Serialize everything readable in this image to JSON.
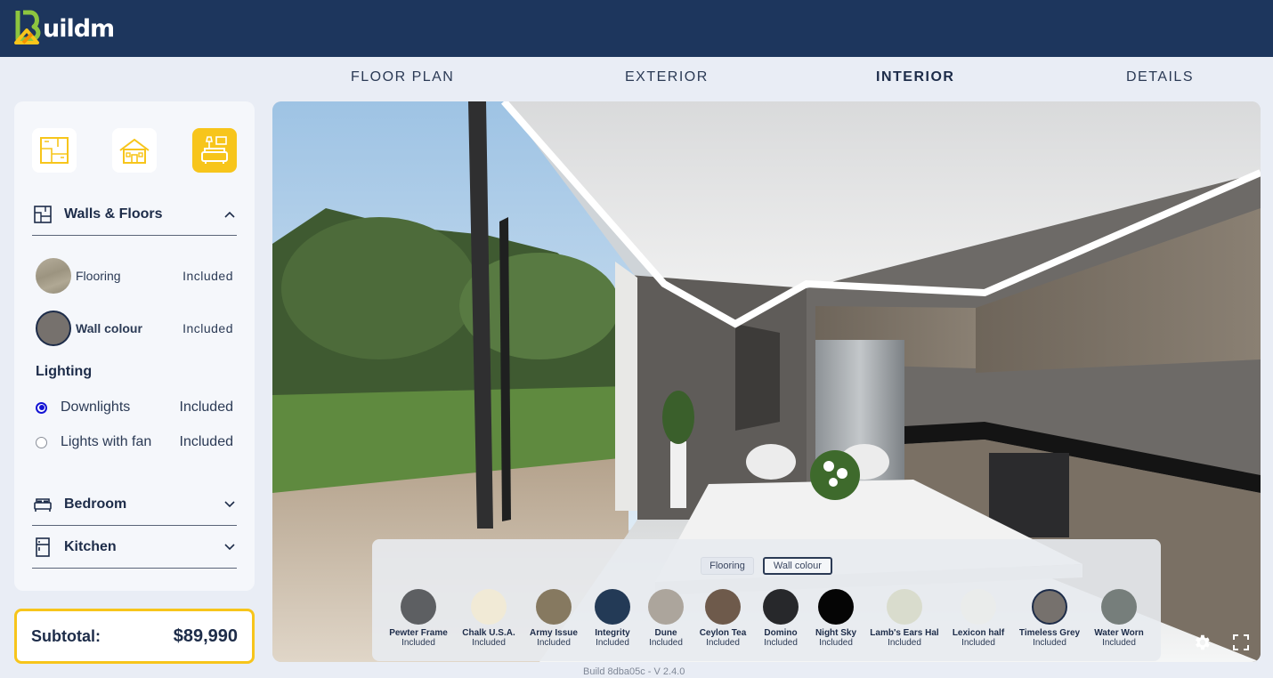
{
  "brand": {
    "logo_text": "uildm",
    "logo_initial": "B"
  },
  "tabs": [
    {
      "label": "FLOOR PLAN",
      "active": false
    },
    {
      "label": "EXTERIOR",
      "active": false
    },
    {
      "label": "INTERIOR",
      "active": true
    },
    {
      "label": "DETAILS",
      "active": false
    }
  ],
  "sidebar": {
    "categories": [
      {
        "icon": "floorplan-icon",
        "active": false
      },
      {
        "icon": "house-icon",
        "active": false
      },
      {
        "icon": "interior-icon",
        "active": true
      }
    ],
    "walls_floors": {
      "title": "Walls & Floors",
      "expanded": true,
      "options": [
        {
          "label": "Flooring",
          "value": "Included",
          "swatch": "#a59f8d"
        },
        {
          "label": "Wall colour",
          "value": "Included",
          "swatch": "#76716d"
        }
      ],
      "lighting_title": "Lighting",
      "lighting": [
        {
          "label": "Downlights",
          "value": "Included",
          "checked": true
        },
        {
          "label": "Lights with fan",
          "value": "Included",
          "checked": false
        }
      ]
    },
    "bedroom": {
      "title": "Bedroom"
    },
    "kitchen": {
      "title": "Kitchen"
    }
  },
  "subtotal": {
    "label": "Subtotal:",
    "value": "$89,990"
  },
  "palette": {
    "chips": [
      {
        "label": "Flooring",
        "active": false
      },
      {
        "label": "Wall colour",
        "active": true
      }
    ],
    "colours": [
      {
        "name": "Pewter Frame",
        "value": "Included",
        "hex": "#5d5f62"
      },
      {
        "name": "Chalk U.S.A.",
        "value": "Included",
        "hex": "#f1ead6"
      },
      {
        "name": "Army Issue",
        "value": "Included",
        "hex": "#867960"
      },
      {
        "name": "Integrity",
        "value": "Included",
        "hex": "#233a56"
      },
      {
        "name": "Dune",
        "value": "Included",
        "hex": "#aca59c"
      },
      {
        "name": "Ceylon Tea",
        "value": "Included",
        "hex": "#6e5a4b"
      },
      {
        "name": "Domino",
        "value": "Included",
        "hex": "#27282b"
      },
      {
        "name": "Night Sky",
        "value": "Included",
        "hex": "#050505"
      },
      {
        "name": "Lamb's Ears Hal",
        "value": "Included",
        "hex": "#d9dccd"
      },
      {
        "name": "Lexicon half",
        "value": "Included",
        "hex": "#eaeceb"
      },
      {
        "name": "Timeless Grey",
        "value": "Included",
        "hex": "#76716d",
        "selected": true
      },
      {
        "name": "Water Worn",
        "value": "Included",
        "hex": "#767e7b"
      }
    ]
  },
  "viewer_controls": {
    "settings_icon": "gear-icon",
    "fullscreen_icon": "fullscreen-icon"
  },
  "build": "Build 8dba05c - V 2.4.0"
}
